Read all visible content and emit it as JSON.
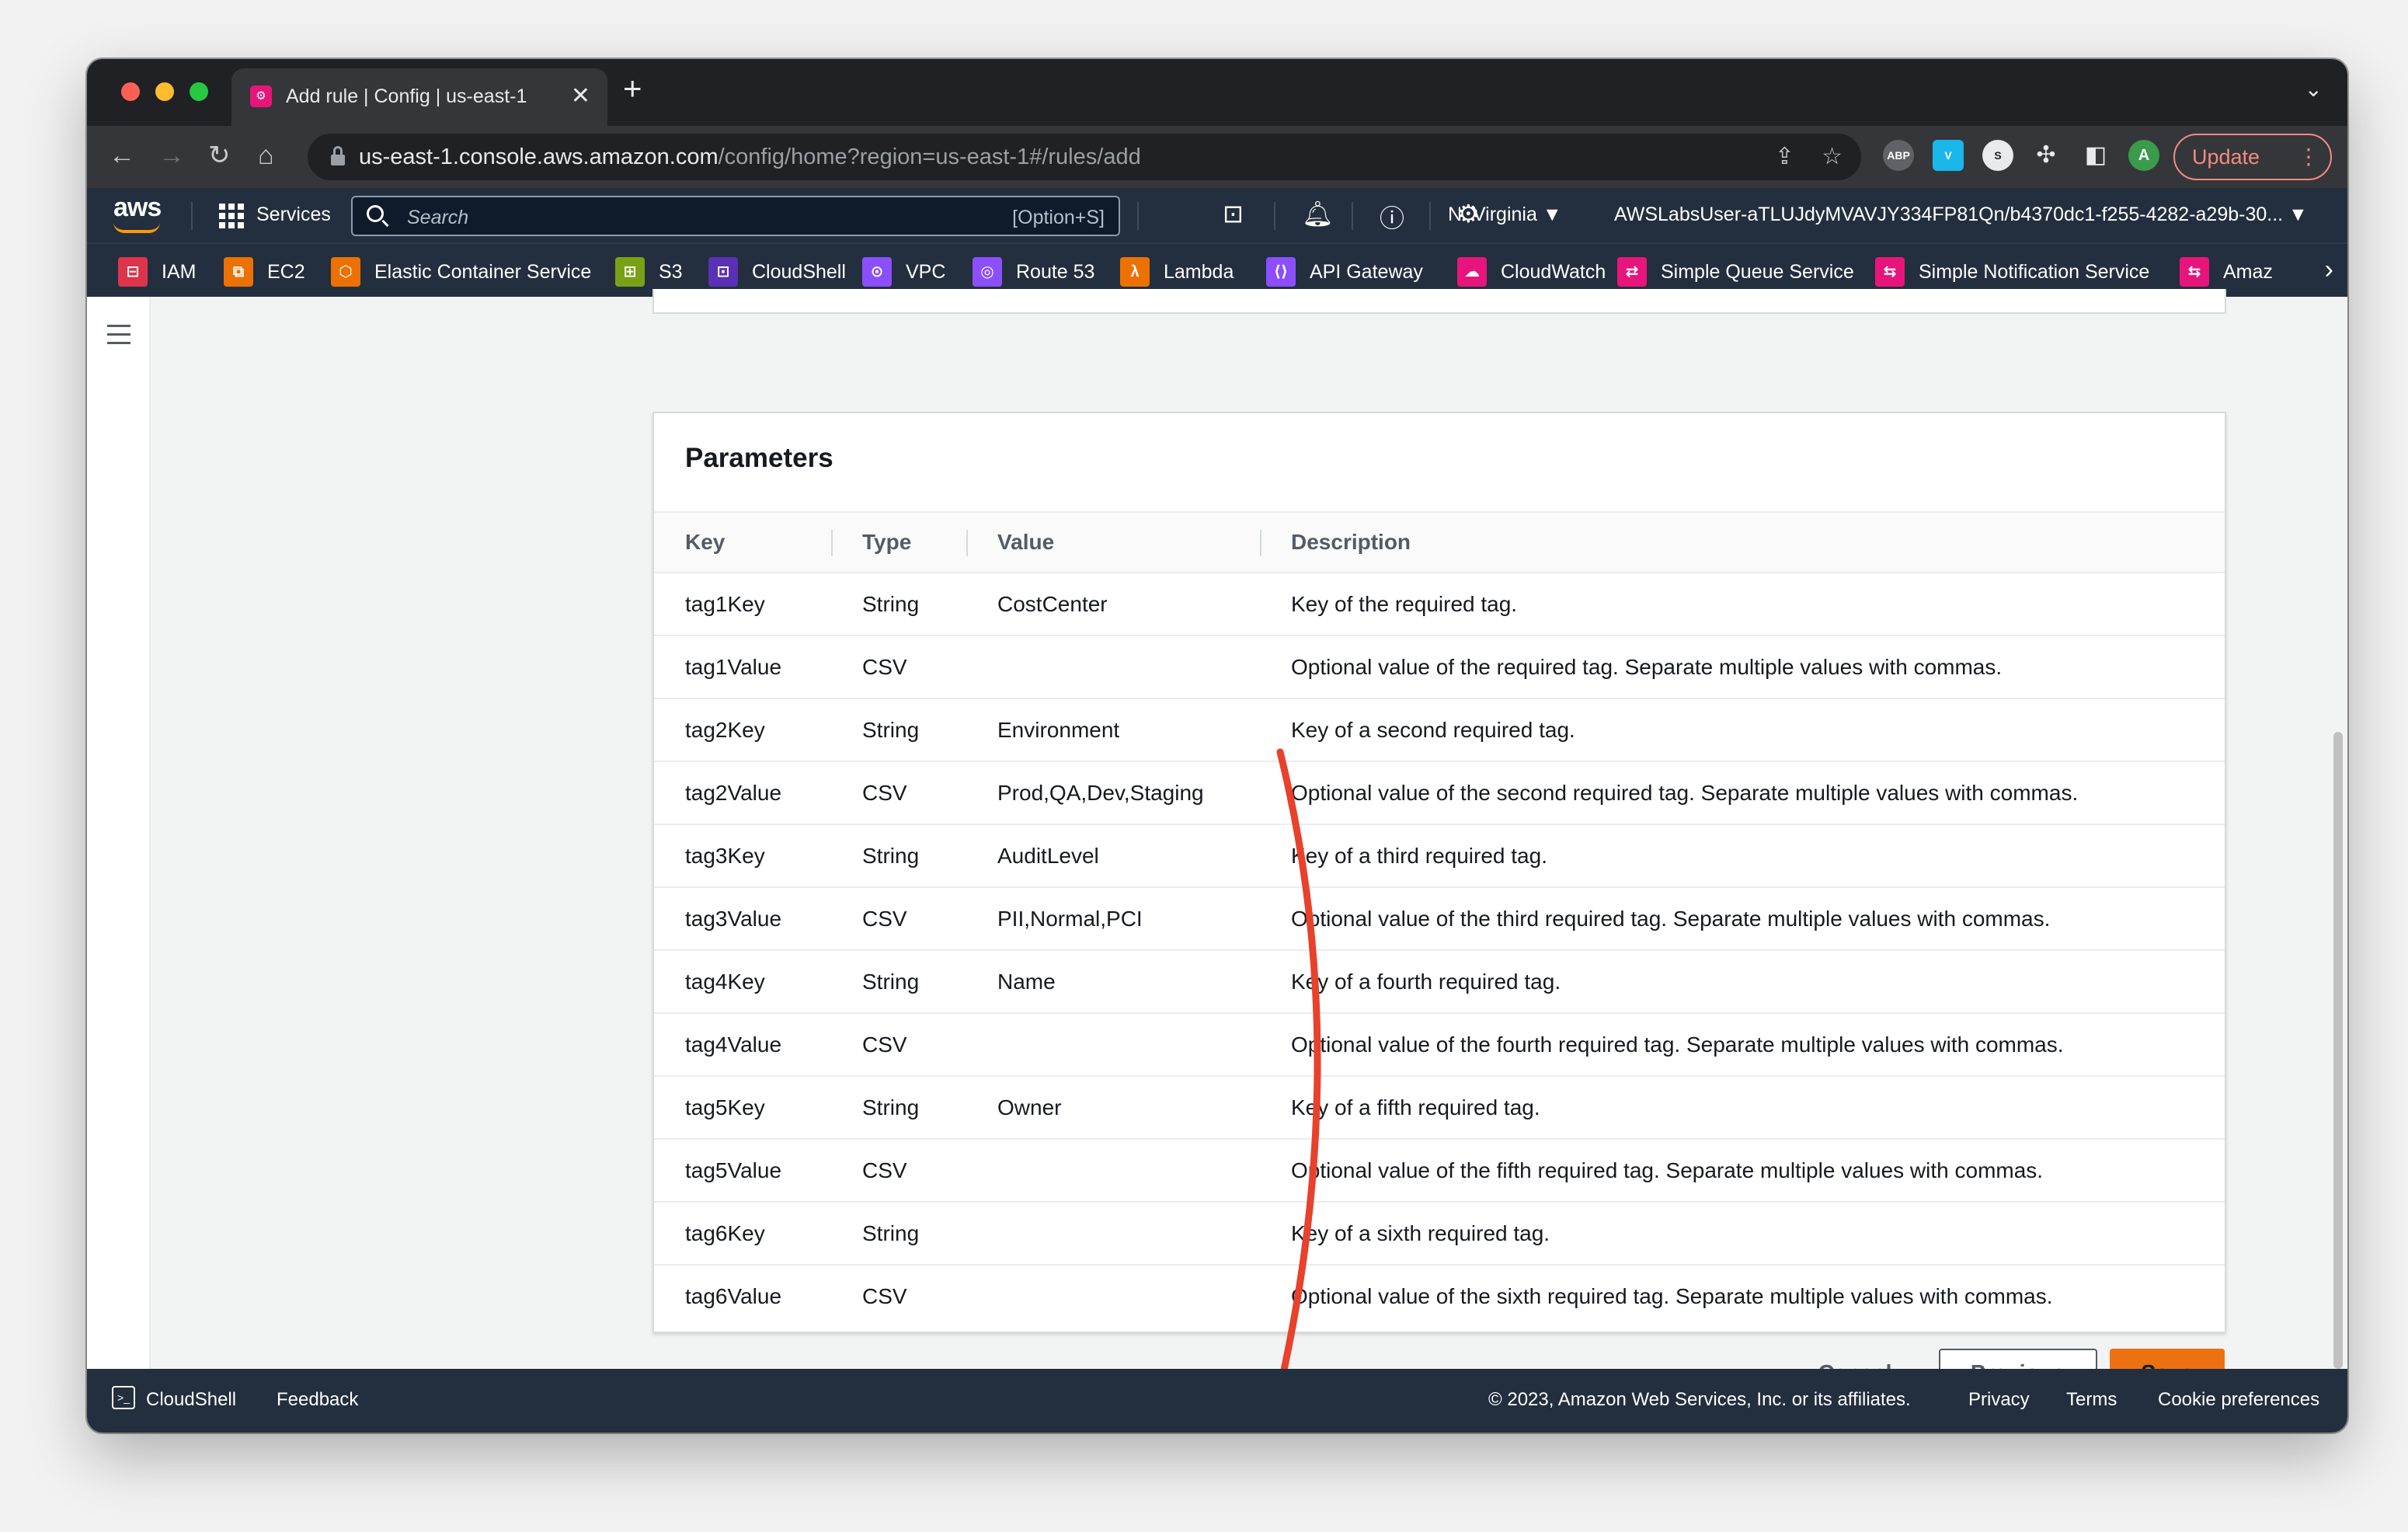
{
  "browser": {
    "tab_title": "Add rule | Config | us-east-1",
    "url_host": "us-east-1.console.aws.amazon.com",
    "url_path": "/config/home?region=us-east-1#/rules/add",
    "update_label": "Update",
    "profile_initial": "A"
  },
  "aws_nav": {
    "services_label": "Services",
    "search_placeholder": "Search",
    "search_shortcut": "[Option+S]",
    "region": "N. Virginia ▼",
    "account": "AWSLabsUser-aTLUJdyMVAVJY334FP81Qn/b4370dc1-f255-4282-a29b-30... ▼"
  },
  "favorites": [
    {
      "label": "IAM",
      "icon": "iam-icon",
      "color": "#dd344c"
    },
    {
      "label": "EC2",
      "icon": "ec2-icon",
      "color": "#ed7100"
    },
    {
      "label": "Elastic Container Service",
      "icon": "ecs-icon",
      "color": "#ed7100"
    },
    {
      "label": "S3",
      "icon": "s3-icon",
      "color": "#7aa116"
    },
    {
      "label": "CloudShell",
      "icon": "cloudshell-icon",
      "color": "#5a30b5"
    },
    {
      "label": "VPC",
      "icon": "vpc-icon",
      "color": "#8c4fff"
    },
    {
      "label": "Route 53",
      "icon": "route53-icon",
      "color": "#8c4fff"
    },
    {
      "label": "Lambda",
      "icon": "lambda-icon",
      "color": "#ed7100"
    },
    {
      "label": "API Gateway",
      "icon": "api-gateway-icon",
      "color": "#8c4fff"
    },
    {
      "label": "CloudWatch",
      "icon": "cloudwatch-icon",
      "color": "#e7157b"
    },
    {
      "label": "Simple Queue Service",
      "icon": "sqs-icon",
      "color": "#e7157b"
    },
    {
      "label": "Simple Notification Service",
      "icon": "sns-icon",
      "color": "#e7157b"
    },
    {
      "label": "Amaz",
      "icon": "amazon-service-icon",
      "color": "#e7157b"
    }
  ],
  "parameters": {
    "title": "Parameters",
    "headers": {
      "key": "Key",
      "type": "Type",
      "value": "Value",
      "description": "Description"
    },
    "rows": [
      {
        "key": "tag1Key",
        "type": "String",
        "value": "CostCenter",
        "description": "Key of the required tag."
      },
      {
        "key": "tag1Value",
        "type": "CSV",
        "value": "",
        "description": "Optional value of the required tag. Separate multiple values with commas."
      },
      {
        "key": "tag2Key",
        "type": "String",
        "value": "Environment",
        "description": "Key of a second required tag."
      },
      {
        "key": "tag2Value",
        "type": "CSV",
        "value": "Prod,QA,Dev,Staging",
        "description": "Optional value of the second required tag. Separate multiple values with commas."
      },
      {
        "key": "tag3Key",
        "type": "String",
        "value": "AuditLevel",
        "description": "Key of a third required tag."
      },
      {
        "key": "tag3Value",
        "type": "CSV",
        "value": "PII,Normal,PCI",
        "description": "Optional value of the third required tag. Separate multiple values with commas."
      },
      {
        "key": "tag4Key",
        "type": "String",
        "value": "Name",
        "description": "Key of a fourth required tag."
      },
      {
        "key": "tag4Value",
        "type": "CSV",
        "value": "",
        "description": "Optional value of the fourth required tag. Separate multiple values with commas."
      },
      {
        "key": "tag5Key",
        "type": "String",
        "value": "Owner",
        "description": "Key of a fifth required tag."
      },
      {
        "key": "tag5Value",
        "type": "CSV",
        "value": "",
        "description": "Optional value of the fifth required tag. Separate multiple values with commas."
      },
      {
        "key": "tag6Key",
        "type": "String",
        "value": "",
        "description": "Key of a sixth required tag."
      },
      {
        "key": "tag6Value",
        "type": "CSV",
        "value": "",
        "description": "Optional value of the sixth required tag. Separate multiple values with commas."
      }
    ]
  },
  "actions": {
    "cancel": "Cancel",
    "previous": "Previous",
    "save": "Save"
  },
  "footer": {
    "cloudshell": "CloudShell",
    "feedback": "Feedback",
    "copyright": "© 2023, Amazon Web Services, Inc. or its affiliates.",
    "privacy": "Privacy",
    "terms": "Terms",
    "cookies": "Cookie preferences"
  },
  "colors": {
    "annotation": "#e8412c",
    "save_button": "#ec7211",
    "nav_bg": "#232f3e"
  }
}
